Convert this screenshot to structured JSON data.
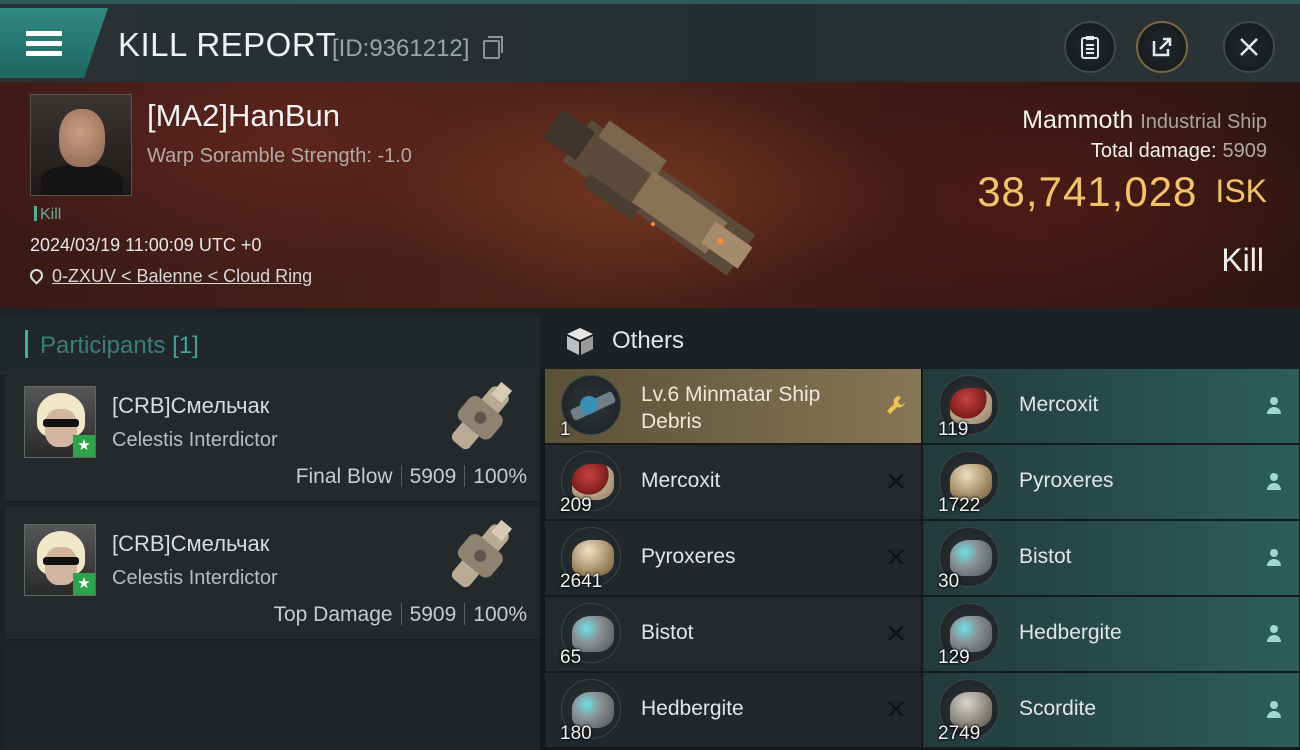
{
  "header": {
    "title": "KILL REPORT",
    "report_id": "[ID:9361212]"
  },
  "victim": {
    "name": "[MA2]HanBun",
    "warp_scramble": "Warp Soramble Strength: -1.0",
    "kill_tag": "Kill",
    "datetime": "2024/03/19 11:00:09 UTC +0",
    "location": "0-ZXUV < Balenne < Cloud Ring",
    "ship_name": "Mammoth",
    "ship_class": "Industrial Ship",
    "total_damage_label": "Total damage:",
    "total_damage": "5909",
    "isk_value": "38,741,028",
    "isk_unit": "ISK",
    "result": "Kill"
  },
  "participants": {
    "label": "Participants",
    "count": "[1]",
    "rows": [
      {
        "name": "[CRB]Смельчак",
        "ship": "Celestis Interdictor",
        "role": "Final Blow",
        "damage": "5909",
        "percent": "100%"
      },
      {
        "name": "[CRB]Смельчак",
        "ship": "Celestis Interdictor",
        "role": "Top Damage",
        "damage": "5909",
        "percent": "100%"
      }
    ]
  },
  "others": {
    "label": "Others",
    "left_column": [
      {
        "name": "Lv.6 Minmatar Ship Debris",
        "qty": "1",
        "status": "wrench-icon"
      },
      {
        "name": "Mercoxit",
        "qty": "209",
        "status": "close-icon"
      },
      {
        "name": "Pyroxeres",
        "qty": "2641",
        "status": "close-icon"
      },
      {
        "name": "Bistot",
        "qty": "65",
        "status": "close-icon"
      },
      {
        "name": "Hedbergite",
        "qty": "180",
        "status": "close-icon"
      }
    ],
    "right_column": [
      {
        "name": "Mercoxit",
        "qty": "119",
        "status": "person-icon"
      },
      {
        "name": "Pyroxeres",
        "qty": "1722",
        "status": "person-icon"
      },
      {
        "name": "Bistot",
        "qty": "30",
        "status": "person-icon"
      },
      {
        "name": "Hedbergite",
        "qty": "129",
        "status": "person-icon"
      },
      {
        "name": "Scordite",
        "qty": "2749",
        "status": "person-icon"
      }
    ]
  },
  "colors": {
    "accent_teal": "#3fb2a1",
    "isk_gold": "#f2c46a",
    "destroyed_bg": "#2d5e5a",
    "highlight_bg": "#877656"
  }
}
